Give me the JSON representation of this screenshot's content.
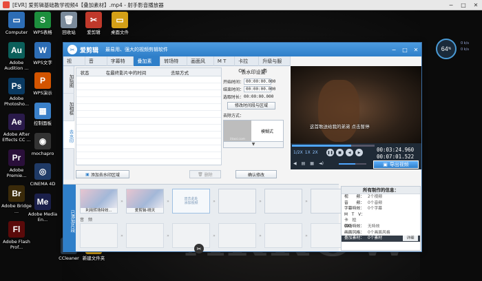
{
  "player": {
    "title": "[EVR] 爱剪辑基础教学视频4【叠加素材】.mp4 - 射手影音播放器"
  },
  "desktop": {
    "col1": [
      {
        "label": "Computer",
        "icon": "computer-icon",
        "color": "#2d6db5",
        "glyph": "▭"
      },
      {
        "label": "Adobe Audition ...",
        "icon": "adobe-audition-icon",
        "color": "#0b5f5a",
        "glyph": "Au"
      },
      {
        "label": "Adobe Photosho...",
        "icon": "adobe-photoshop-icon",
        "color": "#0a3a62",
        "glyph": "Ps"
      },
      {
        "label": "Adobe After Effects CC ...",
        "icon": "adobe-after-effects-icon",
        "color": "#2a1a4a",
        "glyph": "Ae"
      },
      {
        "label": "Adobe Premie...",
        "icon": "adobe-premiere-icon",
        "color": "#2a0f3a",
        "glyph": "Pr"
      },
      {
        "label": "Adobe Bridge ...",
        "icon": "adobe-bridge-icon",
        "color": "#3a2a0a",
        "glyph": "Br"
      },
      {
        "label": "Adobe Flash Prof...",
        "icon": "adobe-flash-icon",
        "color": "#5a0a0a",
        "glyph": "Fl"
      }
    ],
    "col2": [
      {
        "label": "WPS表格",
        "icon": "wps-sheet-icon",
        "color": "#1d8f3d",
        "glyph": "S"
      },
      {
        "label": "WPS文字",
        "icon": "wps-writer-icon",
        "color": "#2d6db5",
        "glyph": "W"
      },
      {
        "label": "WPS演示",
        "icon": "wps-presentation-icon",
        "color": "#d35400",
        "glyph": "P"
      },
      {
        "label": "控制面板",
        "icon": "control-panel-icon",
        "color": "#3a80c9",
        "glyph": "▦"
      },
      {
        "label": "mochapro",
        "icon": "mochapro-icon",
        "color": "#333333",
        "glyph": "◉"
      },
      {
        "label": "CINEMA 4D",
        "icon": "cinema4d-icon",
        "color": "#1f3a66",
        "glyph": "◎"
      },
      {
        "label": "Adobe Media En...",
        "icon": "adobe-media-encoder-icon",
        "color": "#1a1f4a",
        "glyph": "Me"
      }
    ],
    "col3": [
      {
        "label": "回收站",
        "icon": "recycle-bin-icon",
        "color": "#7a8a9a",
        "glyph": "🗑"
      }
    ],
    "col4": [
      {
        "label": "爱剪辑",
        "icon": "aijianji-desktop-icon",
        "color": "#c0392b",
        "glyph": "✂"
      }
    ],
    "col5": [
      {
        "label": "桌面文件",
        "icon": "desktop-folder-icon",
        "color": "#d4a017",
        "glyph": "▭"
      }
    ],
    "bottom": [
      {
        "label": "CCleaner",
        "icon": "ccleaner-icon",
        "color": "#2c3e50",
        "glyph": "C"
      },
      {
        "label": "新建文件夹",
        "icon": "new-folder-icon",
        "color": "#d4a017",
        "glyph": "▭"
      }
    ],
    "background_text": "ARROW",
    "speed": {
      "value": "64",
      "unit": "%",
      "up": "0 k/s",
      "down": "0 k/s"
    }
  },
  "editor": {
    "app_name": "爱剪辑",
    "slogan": "最易用、强大的视频剪辑软件",
    "tabs": [
      {
        "label": "视　频",
        "active": false
      },
      {
        "label": "音　频",
        "active": false
      },
      {
        "label": "字幕特效",
        "active": false
      },
      {
        "label": "叠加素材",
        "active": true
      },
      {
        "label": "转场特效",
        "active": false
      },
      {
        "label": "画面风格",
        "active": false
      },
      {
        "label": "M T V",
        "active": false
      },
      {
        "label": "卡拉OK",
        "active": false
      },
      {
        "label": "升级与服务",
        "active": false
      }
    ],
    "vtabs": [
      {
        "label": "加贴图",
        "active": false
      },
      {
        "label": "加相框",
        "active": false
      },
      {
        "label": "去水印",
        "active": true
      }
    ],
    "table_headers": [
      "状态",
      "在最终影片中的时间",
      "去除方式"
    ],
    "watermark": {
      "title": "去水印设置",
      "start_label": "开始时间：",
      "start_value": "00:00:00.000",
      "end_label": "结束时间：",
      "end_value": "00:00:00.000",
      "duration_label": "选取时长：",
      "duration_value": "00:00:00.000",
      "modify_button": "修改时间段与区域",
      "method_label": "去除方式：",
      "thumb_text": "iitaoi.com",
      "method_value": "模糊式"
    },
    "add_button": "添加去水印区域",
    "delete_button": "删除",
    "confirm_button": "确认修改",
    "preview_subtitle": "这首歌送给我的弟弟  点击暂停",
    "speeds": [
      "1/2X",
      "1X",
      "2X"
    ],
    "time_current": "00:03:24.960",
    "time_total": "00:07:01.522",
    "progress": 0.72,
    "volume": 0.6,
    "export_button": "导出视频",
    "timeline": {
      "side_label": "已添加片段",
      "clips": [
        {
          "caption": "利用转场特效...",
          "type": "clip"
        },
        {
          "caption": "爱剪辑-晴天",
          "type": "clip"
        },
        {
          "caption": "双击此处\n添加视频",
          "type": "slot"
        },
        {
          "caption": "",
          "type": "empty"
        },
        {
          "caption": "",
          "type": "empty"
        },
        {
          "caption": "",
          "type": "empty"
        }
      ],
      "audio_label": "音　频"
    },
    "info": {
      "title": "所有制作的信息：",
      "rows": [
        {
          "k": "视　　频：",
          "v": "2个视频"
        },
        {
          "k": "音　　频：",
          "v": "0个音频"
        },
        {
          "k": "字幕特效：",
          "v": "0个字幕"
        },
        {
          "k": "M　T　V：",
          "v": ""
        },
        {
          "k": "卡　拉　OK：",
          "v": ""
        },
        {
          "k": "转场特效：",
          "v": "无特效"
        },
        {
          "k": "画面风格：",
          "v": "0个画面风格"
        },
        {
          "k": "叠加素材：",
          "v": "0个素材"
        }
      ],
      "detail_button": "详细"
    }
  }
}
